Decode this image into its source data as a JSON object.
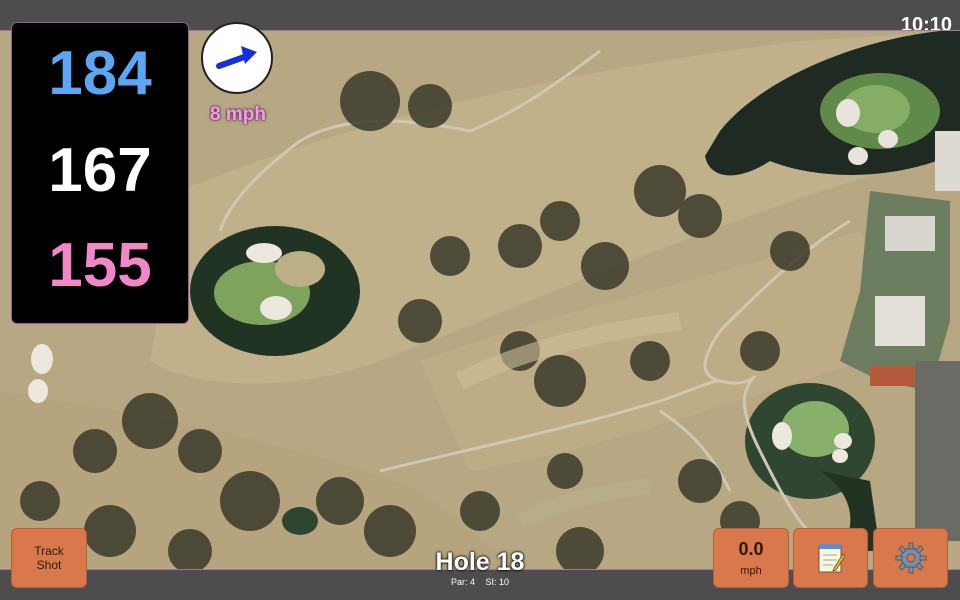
{
  "status_bar": {
    "time": "10:10"
  },
  "yardages": {
    "back": "184",
    "middle": "167",
    "front": "155"
  },
  "wind": {
    "speed_label": "8 mph",
    "direction_icon": "arrow-up-right-icon"
  },
  "hole": {
    "title": "Hole 18",
    "par_label": "Par: 4",
    "si_label": "SI: 10"
  },
  "buttons": {
    "track_shot_line1": "Track",
    "track_shot_line2": "Shot",
    "speed_value": "0.0",
    "speed_unit": "mph",
    "notes_icon": "notepad-icon",
    "settings_icon": "gear-icon"
  },
  "colors": {
    "back_yardage": "#5aa8f5",
    "middle_yardage": "#ffffff",
    "front_yardage": "#f287c8",
    "wind_label": "#f59ee6",
    "button": "#d9784a"
  }
}
